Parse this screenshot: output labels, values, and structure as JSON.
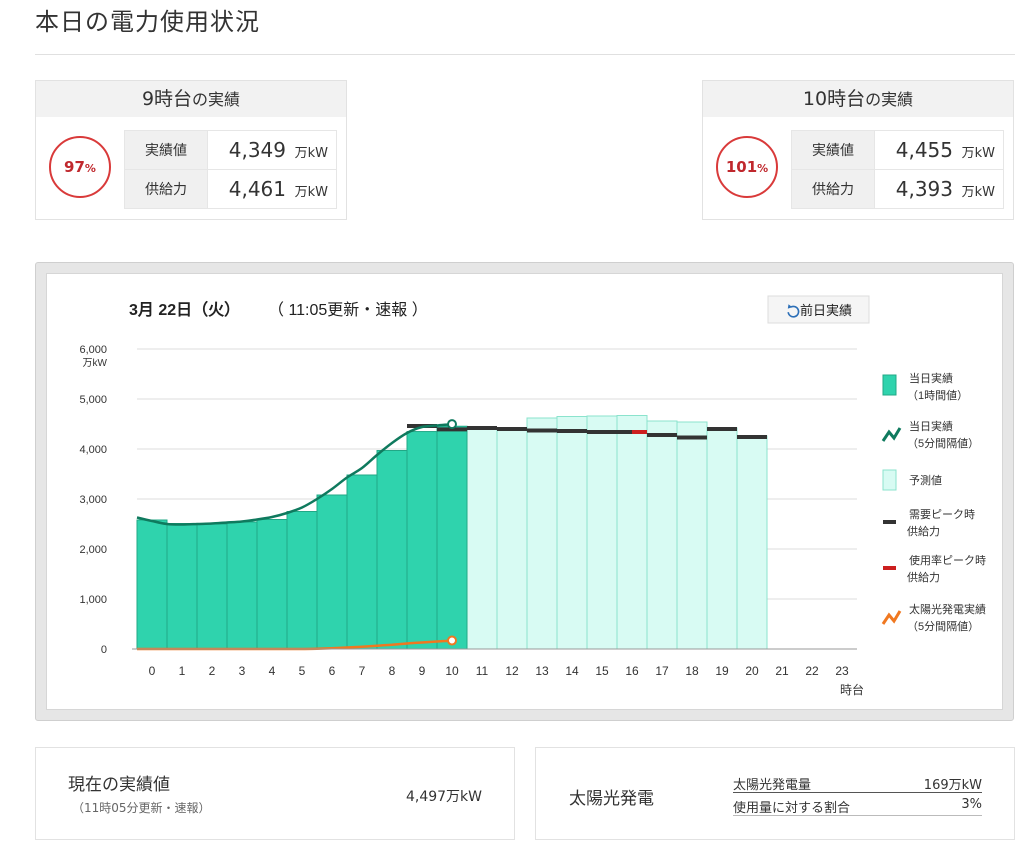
{
  "page": {
    "title": "本日の電力使用状況"
  },
  "hour_cards": [
    {
      "hour": "9時台",
      "suffix": "の実績",
      "usage_rate": "97",
      "usage_unit": "%",
      "rows": [
        {
          "label": "実績値",
          "value": "4,349",
          "unit": "万kW"
        },
        {
          "label": "供給力",
          "value": "4,461",
          "unit": "万kW"
        }
      ]
    },
    {
      "hour": "10時台",
      "suffix": "の実績",
      "usage_rate": "101",
      "usage_unit": "%",
      "rows": [
        {
          "label": "実績値",
          "value": "4,455",
          "unit": "万kW"
        },
        {
          "label": "供給力",
          "value": "4,393",
          "unit": "万kW"
        }
      ]
    }
  ],
  "chart_header": {
    "date": "3月 22日（火）",
    "status": "（ 11:05更新・速報 ）",
    "prev_day_button": "前日実績"
  },
  "colors": {
    "actual_fill": "#2fd3ad",
    "actual_stroke": "#21a886",
    "forecast_fill": "#d8fbf3",
    "forecast_stroke": "#8be3cd",
    "five_min_line": "#0f7a5e",
    "supply_mark": "#333333",
    "peak_supply_mark": "#cc1f1f",
    "solar_line": "#f07820",
    "alert_red": "#c0282d"
  },
  "chart_data": {
    "type": "bar",
    "y_unit": "万kW",
    "x_unit": "時台",
    "ylim": [
      0,
      6000
    ],
    "yticks": [
      "6,000",
      "5,000",
      "4,000",
      "3,000",
      "2,000",
      "1,000",
      "0"
    ],
    "categories": [
      "0",
      "1",
      "2",
      "3",
      "4",
      "5",
      "6",
      "7",
      "8",
      "9",
      "10",
      "11",
      "12",
      "13",
      "14",
      "15",
      "16",
      "17",
      "18",
      "19",
      "20",
      "21",
      "22",
      "23"
    ],
    "actual_hourly": [
      2580,
      2510,
      2500,
      2540,
      2590,
      2750,
      3080,
      3480,
      3970,
      4349,
      4455,
      null,
      null,
      null,
      null,
      null,
      null,
      null,
      null,
      null,
      null,
      null,
      null,
      null
    ],
    "forecast": [
      null,
      null,
      null,
      null,
      null,
      null,
      null,
      null,
      null,
      null,
      null,
      4420,
      4410,
      4620,
      4650,
      4660,
      4670,
      4560,
      4540,
      4420,
      4260,
      null,
      null,
      null
    ],
    "demand_peak_supply": [
      null,
      null,
      null,
      null,
      null,
      null,
      null,
      null,
      null,
      4461,
      4393,
      4420,
      4400,
      4370,
      4360,
      4340,
      4340,
      4280,
      4230,
      4400,
      4240,
      null,
      null,
      null
    ],
    "usage_peak_supply_hour": "16",
    "actual_5min_x": [
      0,
      0.5,
      1,
      1.5,
      2,
      2.5,
      3,
      3.5,
      4,
      4.5,
      5,
      5.5,
      6,
      6.5,
      7,
      7.5,
      8,
      8.5,
      9,
      9.5,
      10,
      10.5
    ],
    "actual_5min": [
      2630,
      2560,
      2500,
      2490,
      2500,
      2510,
      2530,
      2550,
      2590,
      2640,
      2720,
      2830,
      3000,
      3200,
      3430,
      3620,
      3880,
      4120,
      4320,
      4440,
      4470,
      4497
    ],
    "solar_5min_x": [
      0,
      1,
      2,
      3,
      4,
      5,
      5.5,
      6,
      6.5,
      7,
      7.5,
      8,
      8.5,
      9,
      9.5,
      10,
      10.5
    ],
    "solar_5min": [
      0,
      0,
      0,
      0,
      0,
      0,
      0,
      5,
      15,
      30,
      45,
      65,
      85,
      110,
      130,
      150,
      169
    ],
    "legend": [
      {
        "kind": "bar-actual",
        "line1": "当日実績",
        "line2": "（1時間値）"
      },
      {
        "kind": "line-actual",
        "line1": "当日実績",
        "line2": "（5分間隔値）"
      },
      {
        "kind": "bar-forecast",
        "line1": "予測値",
        "line2": ""
      },
      {
        "kind": "dash-black",
        "line1": "需要ピーク時",
        "line2": "供給力"
      },
      {
        "kind": "dash-red",
        "line1": "使用率ピーク時",
        "line2": "供給力"
      },
      {
        "kind": "line-solar",
        "line1": "太陽光発電実績",
        "line2": "（5分間隔値）"
      }
    ],
    "legend_position": "right",
    "grid": true
  },
  "current": {
    "title": "現在の実績値",
    "subtitle": "（11時05分更新・速報）",
    "value": "4,497万kW"
  },
  "solar": {
    "title": "太陽光発電",
    "rows": [
      {
        "label": "太陽光発電量",
        "value": "169万kW"
      },
      {
        "label": "使用量に対する割合",
        "value": "3%"
      }
    ]
  }
}
